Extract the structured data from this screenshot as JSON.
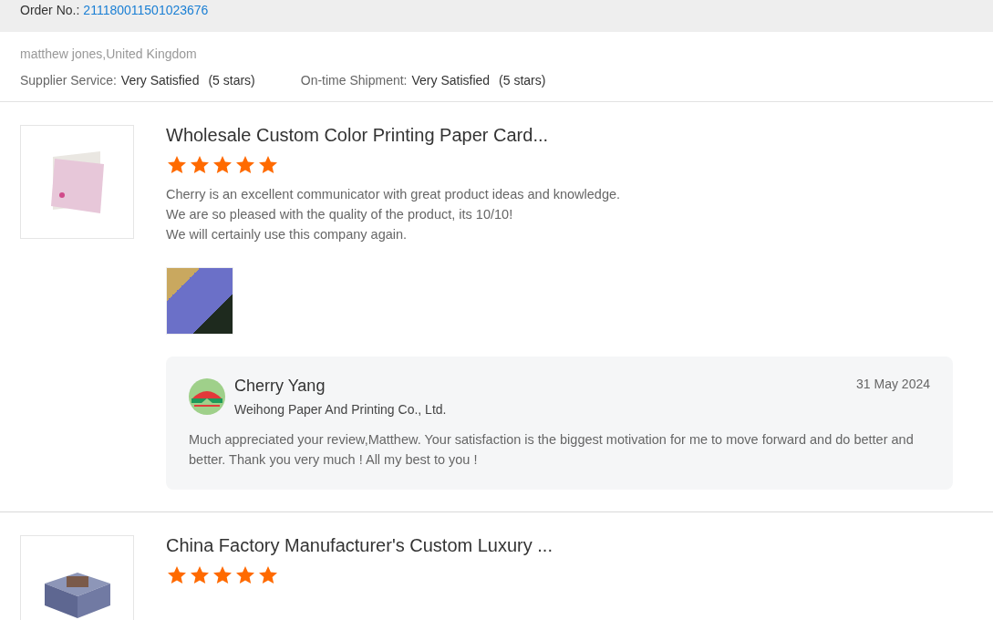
{
  "order": {
    "label": "Order No.:",
    "number": "211180011501023676"
  },
  "buyer": {
    "name": "matthew jones,United Kingdom",
    "ratings": [
      {
        "label": "Supplier Service:",
        "value": "Very Satisfied",
        "stars_text": "(5 stars)"
      },
      {
        "label": "On-time Shipment:",
        "value": "Very Satisfied",
        "stars_text": "(5 stars)"
      }
    ]
  },
  "reviews": [
    {
      "product_title": "Wholesale Custom Color Printing Paper Card...",
      "kind": "card",
      "stars": 5,
      "comment": [
        "Cherry is an excellent communicator with great product ideas and knowledge.",
        "We are so pleased with the quality of the product, its 10/10!",
        "We will certainly use this company again."
      ],
      "has_photo": true,
      "reply": {
        "name": "Cherry Yang",
        "company": "Weihong Paper And Printing Co., Ltd.",
        "date": "31 May 2024",
        "text": "Much appreciated your review,Matthew. Your satisfaction is the biggest motivation for me to move forward and do better and better. Thank you very much ! All my best to you !"
      }
    },
    {
      "product_title": "China Factory Manufacturer's Custom Luxury ...",
      "kind": "box",
      "stars": 5
    }
  ]
}
